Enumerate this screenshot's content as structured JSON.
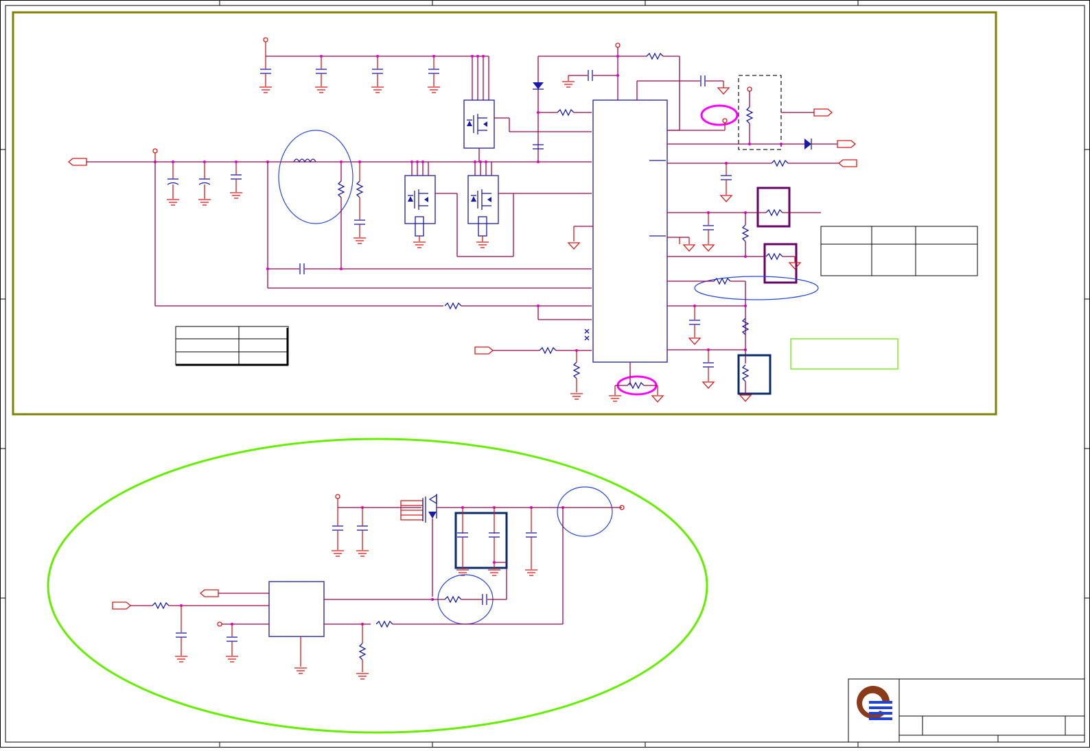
{
  "sheet": {
    "colors": {
      "wire": "#a0004a",
      "pin": "#d81818",
      "component": "#1a1aa8",
      "junction": "#e000c8",
      "frame_olive": "#808000",
      "highlight_magenta": "#ff00ff",
      "highlight_green": "#66ee00",
      "box_purple": "#660066",
      "box_navy": "#0a2a6a",
      "logo_brown": "#8b3a1a",
      "logo_blue": "#2244cc"
    },
    "icons": {
      "logo": "company-logo-icon",
      "ground": "ground-icon",
      "mosfet": "mosfet-icon",
      "diode": "diode-icon",
      "inductor": "inductor-icon",
      "resistor": "resistor-icon",
      "capacitor": "capacitor-icon",
      "offpage_connector": "offpage-connector-icon"
    }
  }
}
